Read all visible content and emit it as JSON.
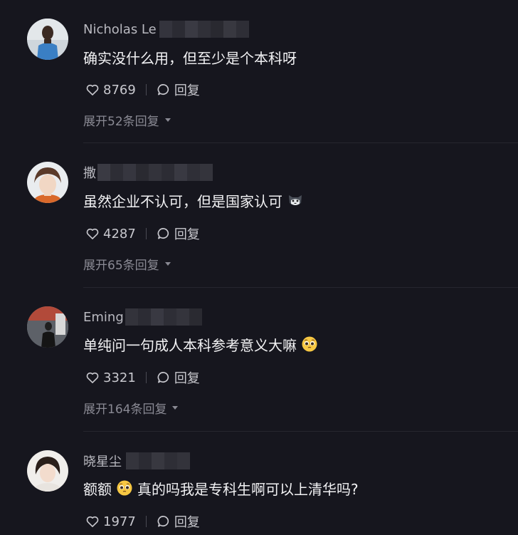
{
  "comments": [
    {
      "username": "Nicholas Le",
      "content": "确实没什么用，但至少是个本科呀",
      "likes": "8769",
      "reply_label": "回复",
      "expand_label": "展开52条回复",
      "emoji": ""
    },
    {
      "username": "撒",
      "content": "虽然企业不认可，但是国家认可",
      "likes": "4287",
      "reply_label": "回复",
      "expand_label": "展开65条回复",
      "emoji": "cat-face-emoji"
    },
    {
      "username": "Eming",
      "content": "单纯问一句成人本科参考意义大嘛",
      "likes": "3321",
      "reply_label": "回复",
      "expand_label": "展开164条回复",
      "emoji": "pleading-face-emoji"
    },
    {
      "username": "晓星尘",
      "content_pre": "额额",
      "content_post": "真的吗我是专科生啊可以上清华吗?",
      "likes": "1977",
      "reply_label": "回复",
      "emoji": "pleading-face-emoji"
    }
  ],
  "colors": {
    "background": "#16161e",
    "text": "#f2f2f4",
    "muted": "#8a8a94"
  }
}
